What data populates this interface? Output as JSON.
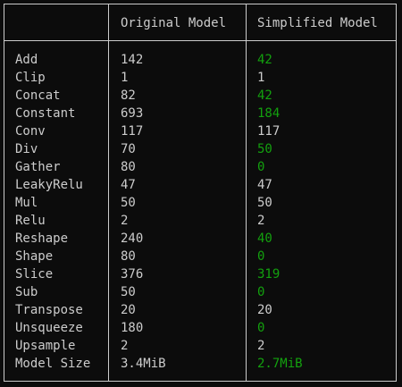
{
  "table": {
    "headers": {
      "operator": "",
      "original": "Original Model",
      "simplified": "Simplified Model"
    },
    "rows": [
      {
        "op": "Add",
        "original": "142",
        "simplified": "42",
        "changed": true
      },
      {
        "op": "Clip",
        "original": "1",
        "simplified": "1",
        "changed": false
      },
      {
        "op": "Concat",
        "original": "82",
        "simplified": "42",
        "changed": true
      },
      {
        "op": "Constant",
        "original": "693",
        "simplified": "184",
        "changed": true
      },
      {
        "op": "Conv",
        "original": "117",
        "simplified": "117",
        "changed": false
      },
      {
        "op": "Div",
        "original": "70",
        "simplified": "50",
        "changed": true
      },
      {
        "op": "Gather",
        "original": "80",
        "simplified": "0",
        "changed": true
      },
      {
        "op": "LeakyRelu",
        "original": "47",
        "simplified": "47",
        "changed": false
      },
      {
        "op": "Mul",
        "original": "50",
        "simplified": "50",
        "changed": false
      },
      {
        "op": "Relu",
        "original": "2",
        "simplified": "2",
        "changed": false
      },
      {
        "op": "Reshape",
        "original": "240",
        "simplified": "40",
        "changed": true
      },
      {
        "op": "Shape",
        "original": "80",
        "simplified": "0",
        "changed": true
      },
      {
        "op": "Slice",
        "original": "376",
        "simplified": "319",
        "changed": true
      },
      {
        "op": "Sub",
        "original": "50",
        "simplified": "0",
        "changed": true
      },
      {
        "op": "Transpose",
        "original": "20",
        "simplified": "20",
        "changed": false
      },
      {
        "op": "Unsqueeze",
        "original": "180",
        "simplified": "0",
        "changed": true
      },
      {
        "op": "Upsample",
        "original": "2",
        "simplified": "2",
        "changed": false
      },
      {
        "op": "Model Size",
        "original": "3.4MiB",
        "simplified": "2.7MiB",
        "changed": true
      }
    ]
  },
  "colors": {
    "background": "#0c0c0c",
    "text": "#cccccc",
    "border": "#cccccc",
    "changed": "#13a10e"
  }
}
